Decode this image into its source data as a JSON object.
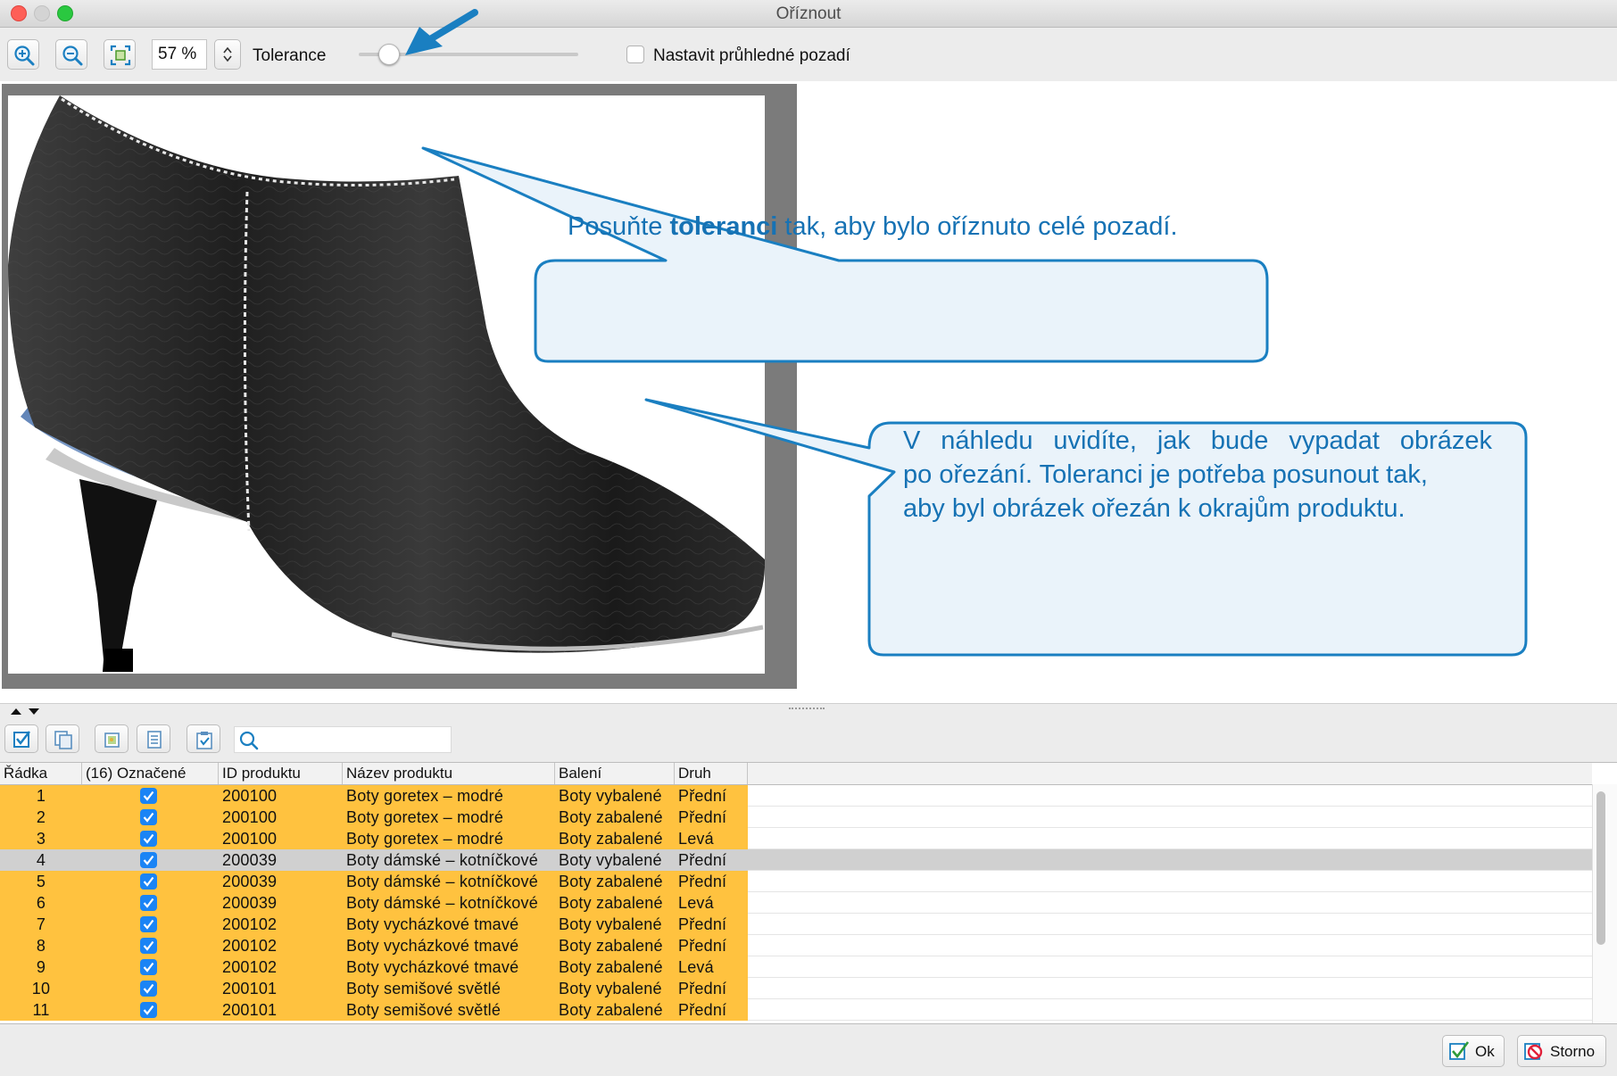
{
  "window": {
    "title": "Oříznout"
  },
  "toolbar": {
    "zoom_in": "zoom-in-icon",
    "zoom_out": "zoom-out-icon",
    "fit": "fit-icon",
    "zoom_value": "57 %",
    "tolerance_label": "Tolerance",
    "tolerance_level": 0.12,
    "transparent_label": "Nastavit průhledné pozadí",
    "transparent_checked": false
  },
  "callouts": {
    "top_pre": "Posuňte ",
    "top_bold": "toleranci",
    "top_post": " tak, aby bylo oříznuto celé pozadí.",
    "bottom_line1": "V náhledu uvidíte, jak bude vypadat obrázek",
    "bottom_line2": "po ořezání. Toleranci je potřeba posunout tak,",
    "bottom_line3": "aby byl obrázek ořezán k okrajům produktu."
  },
  "grid": {
    "columns": {
      "row": "Řádka",
      "marked": "(16) Označené",
      "id": "ID produktu",
      "name": "Název produktu",
      "packing": "Balení",
      "kind": "Druh"
    },
    "rows": [
      {
        "n": "1",
        "id": "200100",
        "name": "Boty goretex – modré",
        "packing": "Boty vybalené",
        "kind": "Přední",
        "checked": true
      },
      {
        "n": "2",
        "id": "200100",
        "name": "Boty goretex – modré",
        "packing": "Boty zabalené",
        "kind": "Přední",
        "checked": true
      },
      {
        "n": "3",
        "id": "200100",
        "name": "Boty goretex – modré",
        "packing": "Boty zabalené",
        "kind": "Levá",
        "checked": true
      },
      {
        "n": "4",
        "id": "200039",
        "name": "Boty dámské – kotníčkové",
        "packing": "Boty vybalené",
        "kind": "Přední",
        "checked": true,
        "selected": true
      },
      {
        "n": "5",
        "id": "200039",
        "name": "Boty dámské – kotníčkové",
        "packing": "Boty zabalené",
        "kind": "Přední",
        "checked": true
      },
      {
        "n": "6",
        "id": "200039",
        "name": "Boty dámské – kotníčkové",
        "packing": "Boty zabalené",
        "kind": "Levá",
        "checked": true
      },
      {
        "n": "7",
        "id": "200102",
        "name": "Boty vycházkové tmavé",
        "packing": "Boty vybalené",
        "kind": "Přední",
        "checked": true
      },
      {
        "n": "8",
        "id": "200102",
        "name": "Boty vycházkové tmavé",
        "packing": "Boty zabalené",
        "kind": "Přední",
        "checked": true
      },
      {
        "n": "9",
        "id": "200102",
        "name": "Boty vycházkové tmavé",
        "packing": "Boty zabalené",
        "kind": "Levá",
        "checked": true
      },
      {
        "n": "10",
        "id": "200101",
        "name": "Boty semišové světlé",
        "packing": "Boty vybalené",
        "kind": "Přední",
        "checked": true
      },
      {
        "n": "11",
        "id": "200101",
        "name": "Boty semišové světlé",
        "packing": "Boty zabalené",
        "kind": "Přední",
        "checked": true
      }
    ]
  },
  "buttons": {
    "ok": "Ok",
    "cancel": "Storno"
  },
  "colors": {
    "row_highlight": "#ffc23f",
    "selected_row": "#d0d0d0",
    "callout_border": "#1a7fc1",
    "callout_fill": "#eaf3fa",
    "callout_text": "#1672b4",
    "checkbox": "#1a84f5"
  }
}
